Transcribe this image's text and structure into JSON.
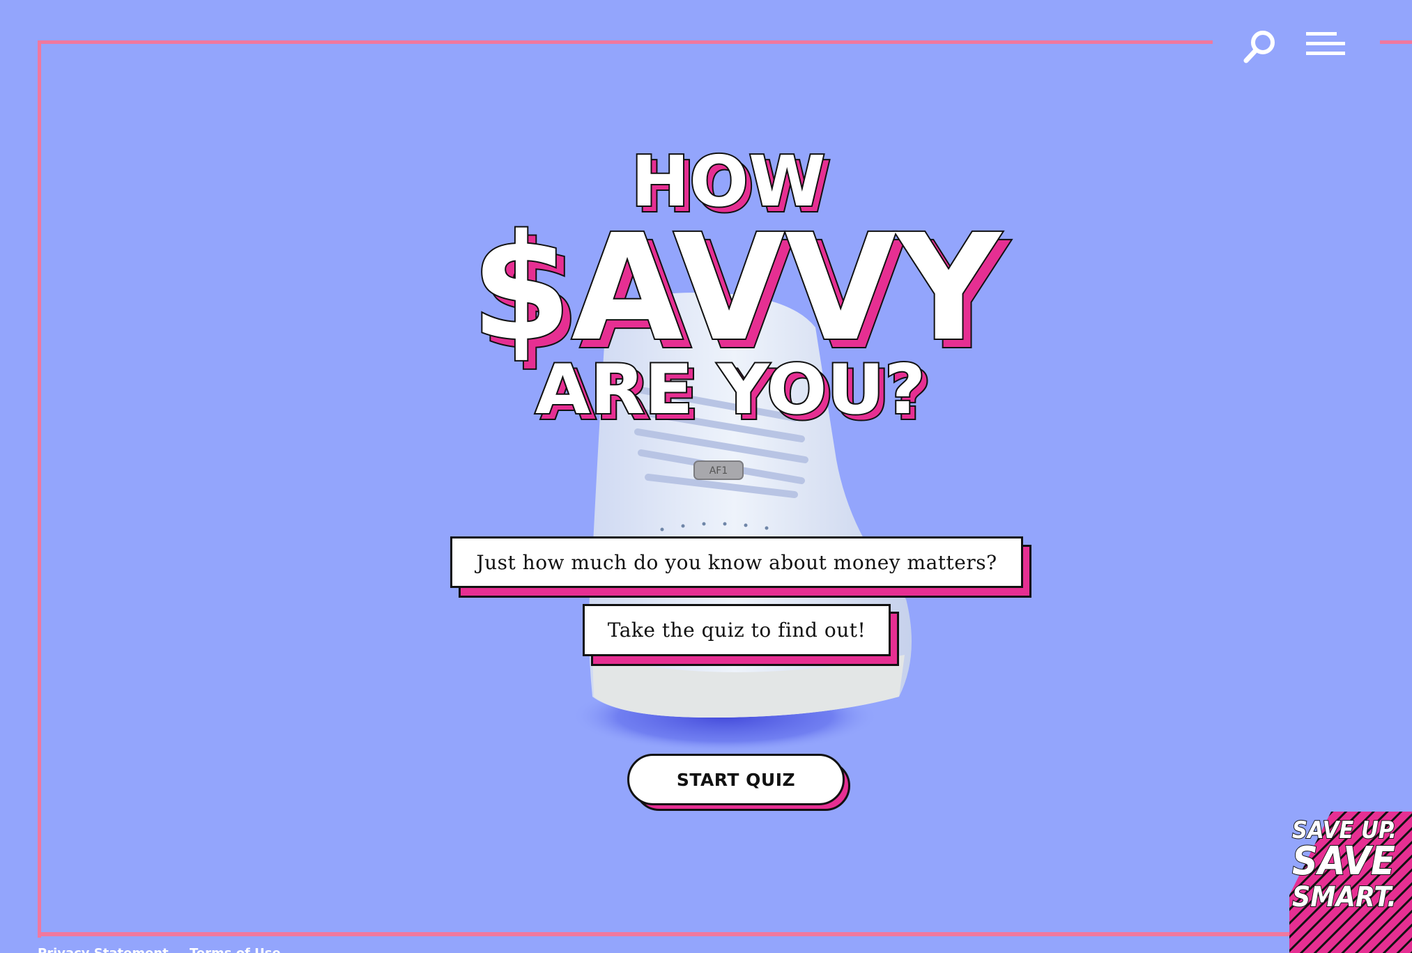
{
  "colors": {
    "background": "#93a5fc",
    "frame": "#f0789e",
    "accent": "#e62f92",
    "outline": "#111111",
    "text_fill": "#ffffff"
  },
  "header": {
    "search_icon": "search-icon",
    "menu_icon": "hamburger-menu-icon"
  },
  "hero": {
    "headline_line1": "HOW",
    "headline_line2": "$AVVY",
    "headline_line3": "ARE YOU?",
    "subtitle": "Just how much do you know about money matters?",
    "prompt": "Take the quiz to find out!",
    "cta_label": "START QUIZ"
  },
  "logo": {
    "line1": "SAVE UP.",
    "line2": "SAVE",
    "line3": "SMART."
  },
  "footer": {
    "links": [
      "Privacy Statement",
      "Terms of Use"
    ]
  }
}
